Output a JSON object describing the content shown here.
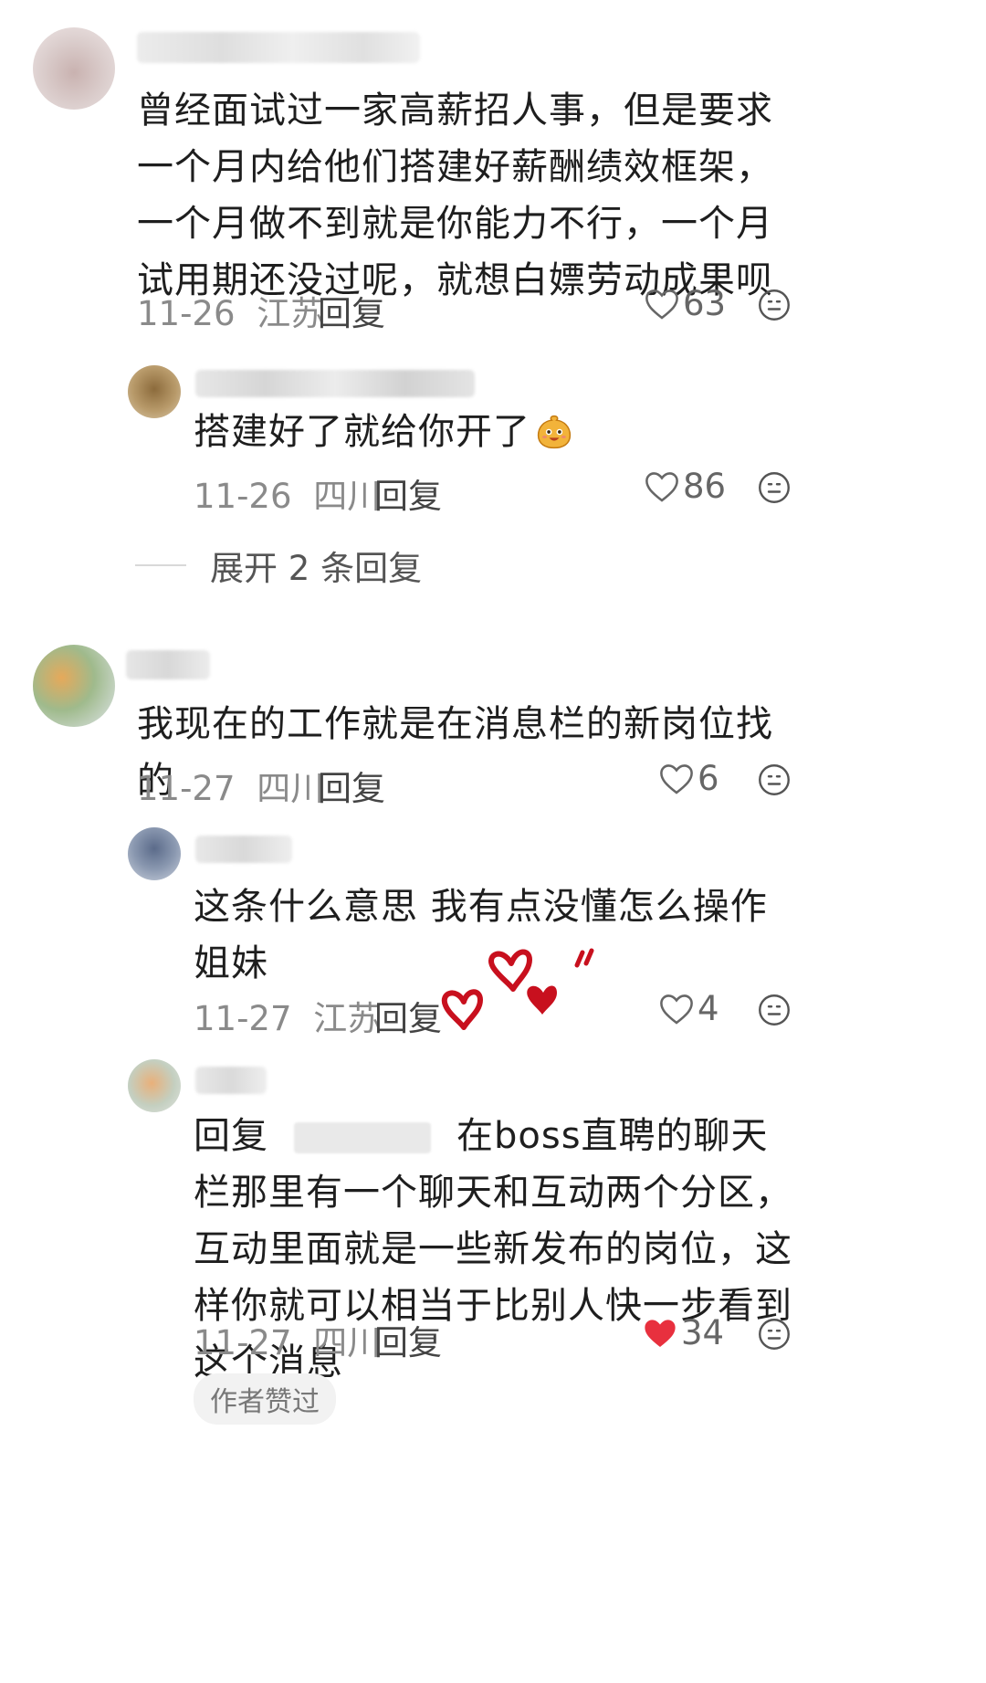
{
  "comments": [
    {
      "text": "曾经面试过一家高薪招人事，但是要求一个月内给他们搭建好薪酬绩效框架，一个月做不到就是你能力不行，一个月试用期还没过呢，就想白嫖劳动成果呗",
      "date": "11-26",
      "location": "江苏",
      "reply_label": "回复",
      "likes": "63",
      "liked": false
    },
    {
      "text": "搭建好了就给你开了",
      "date": "11-26",
      "location": "四川",
      "reply_label": "回复",
      "likes": "86",
      "liked": false
    },
    {
      "text": "我现在的工作就是在消息栏的新岗位找的",
      "date": "11-27",
      "location": "四川",
      "reply_label": "回复",
      "likes": "6",
      "liked": false
    },
    {
      "text": "这条什么意思 我有点没懂怎么操作姐妹",
      "date": "11-27",
      "location": "江苏",
      "reply_label": "回复",
      "likes": "4",
      "liked": false
    },
    {
      "reply_prefix": "回复",
      "text_after_mention": "在boss直聘的聊天栏那里有一个聊天和互动两个分区，互动里面就是一些新发布的岗位，这样你就可以相当于比别人快一步看到这个消息",
      "date": "11-27",
      "location": "四川",
      "reply_label": "回复",
      "likes": "34",
      "liked": true,
      "badge": "作者赞过"
    }
  ],
  "expand_replies": "展开 2 条回复",
  "colors": {
    "liked_heart": "#e8303e",
    "doodle_heart": "#c8101e",
    "text": "#1e1e1e",
    "meta": "#8a8a8a"
  },
  "icons": {
    "like": "heart-outline-icon",
    "liked": "heart-filled-icon",
    "more": "meh-face-icon",
    "emoji": "smiling-face-emoji"
  }
}
